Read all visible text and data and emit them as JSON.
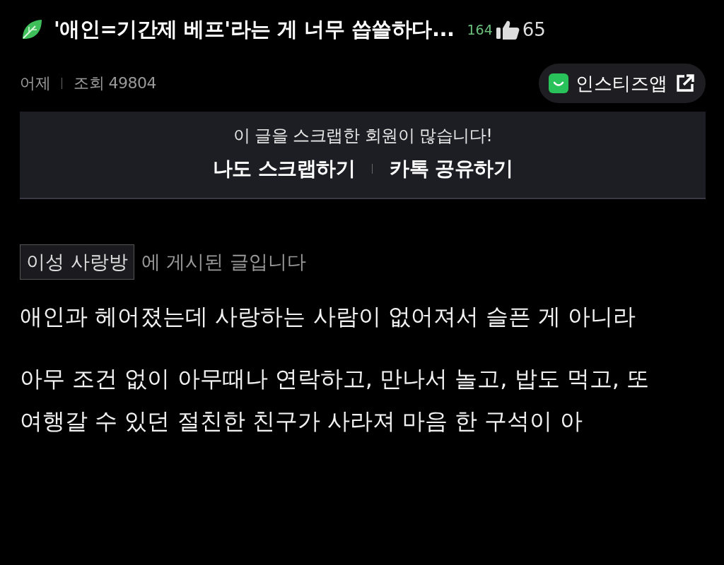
{
  "post": {
    "title": "'애인=기간제 베프'라는 게 너무 씁쓸하다...",
    "comment_count": "164",
    "like_count": "65",
    "date": "어제",
    "views": "조회 49804"
  },
  "app_button": {
    "label": "인스티즈앱"
  },
  "scrap_banner": {
    "message": "이 글을 스크랩한 회원이 많습니다!",
    "actions": [
      "나도 스크랩하기",
      "카톡 공유하기"
    ]
  },
  "board": {
    "name": "이성 사랑방",
    "suffix": "에 게시된 글입니다"
  },
  "paragraphs": [
    "애인과 헤어졌는데 사랑하는 사람이 없어져서 슬픈 게 아니라",
    "아무 조건 없이 아무때나 연락하고, 만나서 놀고, 밥도 먹고, 또 여행갈 수 있던 절친한 친구가 사라져 마음 한 구석이 아"
  ]
}
